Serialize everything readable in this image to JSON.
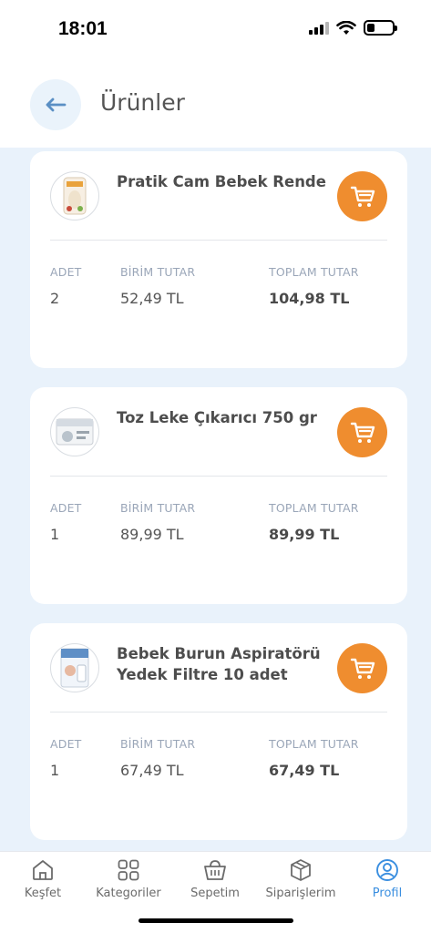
{
  "status_bar": {
    "time": "18:01",
    "battery_level": 0.3
  },
  "header": {
    "title": "Ürünler",
    "back_icon": "arrow-left-icon"
  },
  "labels": {
    "qty": "ADET",
    "unit_price": "BİRİM TUTAR",
    "total_price": "TOPLAM TUTAR"
  },
  "products": [
    {
      "name": "Pratik Cam Bebek Rende",
      "qty": "2",
      "unit_price": "52,49 TL",
      "total_price": "104,98 TL"
    },
    {
      "name": "Toz Leke Çıkarıcı 750 gr",
      "qty": "1",
      "unit_price": "89,99 TL",
      "total_price": "89,99 TL"
    },
    {
      "name": "Bebek Burun Aspiratörü Yedek Filtre 10 adet",
      "qty": "1",
      "unit_price": "67,49 TL",
      "total_price": "67,49 TL"
    }
  ],
  "tabbar": {
    "items": [
      {
        "label": "Keşfet",
        "icon": "home-icon"
      },
      {
        "label": "Kategoriler",
        "icon": "grid-icon"
      },
      {
        "label": "Sepetim",
        "icon": "basket-icon"
      },
      {
        "label": "Siparişlerim",
        "icon": "package-icon"
      },
      {
        "label": "Profil",
        "icon": "user-icon"
      }
    ],
    "active_index": 4
  },
  "colors": {
    "accent_orange": "#ef8d2f",
    "accent_blue": "#3b8fe0",
    "content_bg": "#e9f2fb"
  }
}
